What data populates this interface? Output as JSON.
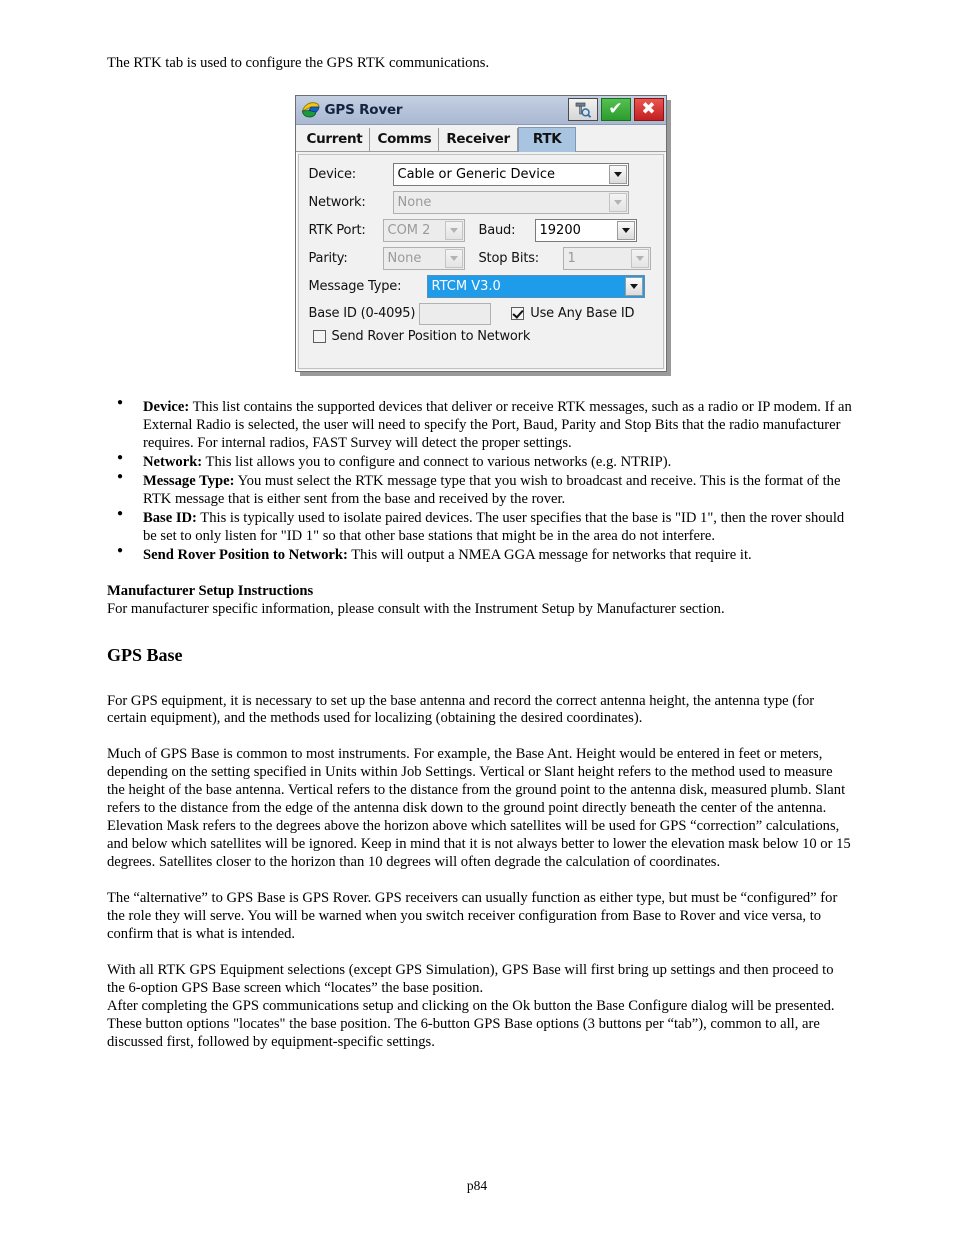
{
  "document": {
    "intro": "The RTK tab is used to configure the GPS RTK communications.",
    "page_number": "p84"
  },
  "dialog": {
    "title": "GPS Rover",
    "app_icon": "globe-logo-icon",
    "titlebar_color": "#b6c3da",
    "buttons": [
      {
        "name": "survey-tool-button",
        "glyph": "",
        "color": "#e0e0e0"
      },
      {
        "name": "ok-button",
        "glyph": "✔",
        "color": "#2b9c2b"
      },
      {
        "name": "cancel-button",
        "glyph": "✖",
        "color": "#c32020"
      }
    ],
    "tabs": [
      {
        "label": "Current",
        "active": false
      },
      {
        "label": "Comms",
        "active": false
      },
      {
        "label": "Receiver",
        "active": false
      },
      {
        "label": "RTK",
        "active": true
      }
    ],
    "fields": {
      "device_label": "Device:",
      "device_value": "Cable or Generic Device",
      "network_label": "Network:",
      "network_value": "None",
      "rtk_port_label": "RTK Port:",
      "rtk_port_value": "COM 2",
      "baud_label": "Baud:",
      "baud_value": "19200",
      "parity_label": "Parity:",
      "parity_value": "None",
      "stop_bits_label": "Stop Bits:",
      "stop_bits_value": "1",
      "message_type_label": "Message Type:",
      "message_type_value": "RTCM V3.0",
      "base_id_label": "Base ID (0-4095)",
      "base_id_value": "",
      "use_any_base_id_label": "Use Any Base ID",
      "use_any_base_id_checked": true,
      "send_rover_label": "Send Rover Position to Network",
      "send_rover_checked": false
    },
    "selection_color": "#1e9cea"
  },
  "bullets": [
    {
      "term": "Device:",
      "text": " This list contains the supported devices that deliver or receive RTK messages, such as a radio or IP modem. If an External Radio is selected, the user will need to specify the Port, Baud, Parity and Stop Bits that the radio manufacturer requires. For internal radios, FAST Survey will detect the proper settings."
    },
    {
      "term": "Network:",
      "text": " This list allows you to configure and connect to various networks (e.g. NTRIP)."
    },
    {
      "term": "Message Type:",
      "text": " You must select the RTK message type that you wish to broadcast and receive. This is the format of the RTK message that is either sent from the base and received  by the rover."
    },
    {
      "term": "Base ID:",
      "text": " This is typically used to isolate paired devices. The user specifies that the base is \"ID 1\", then the rover should be set to only listen for \"ID 1\" so that other base stations that might be in the area do not interfere."
    },
    {
      "term": "Send Rover Position to Network:",
      "text": " This will output a NMEA GGA message for networks that require it."
    }
  ],
  "sections": {
    "manufacturer_heading": "Manufacturer Setup Instructions",
    "manufacturer_body": "For manufacturer specific information, please consult with the Instrument Setup by Manufacturer section.",
    "gps_base_heading": "GPS Base",
    "paragraph_1": "For GPS equipment, it is necessary to set up the base antenna and record the correct antenna height, the antenna type (for certain equipment), and the methods used for localizing (obtaining the desired coordinates).",
    "paragraph_2": "Much of GPS Base is common to most instruments.  For example, the Base Ant. Height would be entered in feet or meters, depending on the setting specified in Units within Job Settings.  Vertical or Slant height refers to the method used to measure the height of the base antenna.  Vertical refers to the distance from the ground point to the antenna disk, measured plumb.  Slant refers to the distance from the edge of the antenna disk down to the ground point directly beneath the center of the antenna.  Elevation Mask refers to the degrees above the horizon above which satellites will be used for GPS “correction” calculations, and below which satellites will be ignored.  Keep in mind that it is not always better to lower the elevation mask below 10 or 15 degrees.  Satellites closer to the horizon than 10 degrees will often degrade the calculation of coordinates.",
    "paragraph_3": "The “alternative” to GPS Base is GPS Rover.  GPS receivers can usually function as either type, but must be “configured” for the role they will serve.  You will be warned when you switch receiver configuration from Base to Rover and vice versa, to confirm that is what is intended.",
    "paragraph_4": "With all RTK GPS Equipment selections (except GPS Simulation), GPS Base will first bring up settings and then proceed to the 6-option GPS Base screen which “locates” the base position.",
    "paragraph_5": "After completing the GPS communications setup and clicking on the Ok button the Base Configure dialog will be presented.  These button options \"locates\" the base position. The 6-button GPS Base options (3 buttons per “tab”), common to all, are discussed first, followed by equipment-specific settings."
  }
}
